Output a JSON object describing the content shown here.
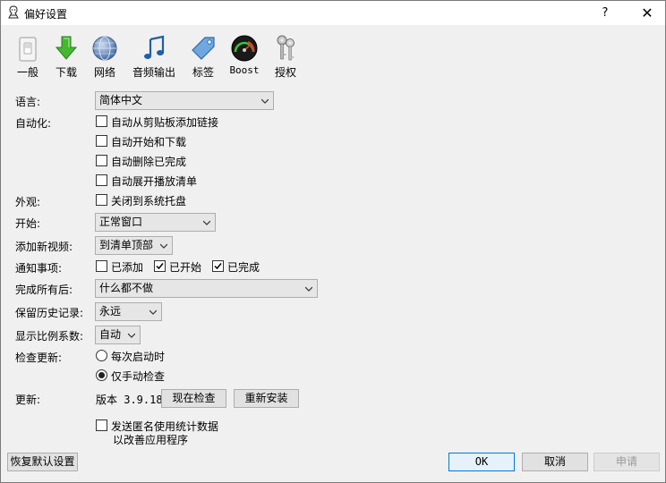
{
  "window": {
    "title": "偏好设置",
    "help": "?",
    "close": "✕"
  },
  "toolbar": [
    {
      "id": "general",
      "label": "一般",
      "icon": "switch-icon"
    },
    {
      "id": "download",
      "label": "下载",
      "icon": "download-arrow-icon"
    },
    {
      "id": "network",
      "label": "网络",
      "icon": "globe-icon"
    },
    {
      "id": "audio",
      "label": "音频输出",
      "icon": "music-note-icon"
    },
    {
      "id": "tags",
      "label": "标签",
      "icon": "tag-icon"
    },
    {
      "id": "boost",
      "label": "Boost",
      "icon": "speedometer-icon"
    },
    {
      "id": "license",
      "label": "授权",
      "icon": "keys-icon"
    }
  ],
  "language": {
    "label": "语言:",
    "value": "简体中文"
  },
  "automation": {
    "label": "自动化:",
    "options": [
      {
        "text": "自动从剪贴板添加链接",
        "checked": false
      },
      {
        "text": "自动开始和下载",
        "checked": false
      },
      {
        "text": "自动删除已完成",
        "checked": false
      },
      {
        "text": "自动展开播放清单",
        "checked": false
      }
    ]
  },
  "appearance": {
    "label": "外观:",
    "option": "关闭到系统托盘",
    "checked": false
  },
  "start": {
    "label": "开始:",
    "value": "正常窗口"
  },
  "add_video": {
    "label": "添加新视频:",
    "value": "到清单顶部"
  },
  "notify": {
    "label": "通知事项:",
    "options": [
      {
        "text": "已添加",
        "checked": false
      },
      {
        "text": "已开始",
        "checked": true
      },
      {
        "text": "已完成",
        "checked": true
      }
    ]
  },
  "after_all": {
    "label": "完成所有后:",
    "value": "什么都不做"
  },
  "history": {
    "label": "保留历史记录:",
    "value": "永远"
  },
  "scale": {
    "label": "显示比例系数:",
    "value": "自动"
  },
  "check_update": {
    "label": "检查更新:",
    "options": [
      {
        "text": "每次启动时",
        "selected": false
      },
      {
        "text": "仅手动检查",
        "selected": true
      }
    ]
  },
  "update": {
    "label": "更新:",
    "version": "版本 3.9.18",
    "check_now": "现在检查",
    "reinstall": "重新安装"
  },
  "stats": {
    "line1": "发送匿名使用统计数据",
    "line2": "以改善应用程序",
    "checked": false
  },
  "footer": {
    "restore": "恢复默认设置",
    "ok": "OK",
    "cancel": "取消",
    "apply": "申请"
  }
}
